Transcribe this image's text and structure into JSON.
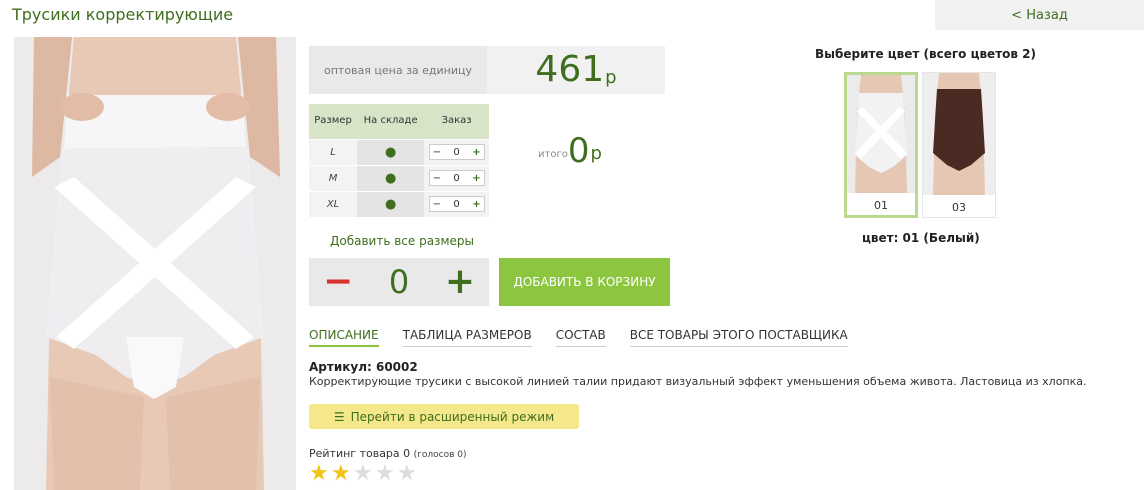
{
  "product": {
    "title": "Трусики корректирующие",
    "back_label": "< Назад",
    "price_label": "оптовая цена за единицу",
    "price": "461",
    "currency": "р",
    "total_label": "итого",
    "total_value": "0",
    "article_label": "Артикул:",
    "article_value": "60002",
    "description": "Корректирующие трусики с высокой линией талии придают визуальный эффект уменьшения объема живота. Ластовица из хлопка."
  },
  "size_table": {
    "headers": [
      "Размер",
      "На складе",
      "Заказ"
    ],
    "rows": [
      {
        "size": "L",
        "stock": "●",
        "qty": "0"
      },
      {
        "size": "M",
        "stock": "●",
        "qty": "0"
      },
      {
        "size": "XL",
        "stock": "●",
        "qty": "0"
      }
    ],
    "minus": "−",
    "plus": "+"
  },
  "order": {
    "add_all_sizes": "Добавить все размеры",
    "qty": "0",
    "minus": "−",
    "plus": "+",
    "add_to_cart": "ДОБАВИТЬ В КОРЗИНУ"
  },
  "tabs": [
    {
      "label": "ОПИСАНИЕ",
      "active": true
    },
    {
      "label": "ТАБЛИЦА РАЗМЕРОВ",
      "active": false
    },
    {
      "label": "СОСТАВ",
      "active": false
    },
    {
      "label": "ВСЕ ТОВАРЫ ЭТОГО ПОСТАВЩИКА",
      "active": false
    }
  ],
  "extended_mode": {
    "icon": "list-icon",
    "icon_glyph": "☰",
    "label": "Перейти в расширенный режим"
  },
  "rating": {
    "label": "Рейтинг товара",
    "value": "0",
    "votes": "(голосов 0)",
    "stars_filled": 2,
    "stars_total": 5
  },
  "colors": {
    "heading": "Выберите цвет (всего цветов 2)",
    "items": [
      {
        "code": "01",
        "selected": true,
        "hex": "#f2f2f4"
      },
      {
        "code": "03",
        "selected": false,
        "hex": "#4a2a22"
      }
    ],
    "caption": "цвет: 01 (Белый)"
  },
  "palette": {
    "accent_green": "#3f6e1e",
    "button_green": "#8cc63f",
    "minus_red": "#d9332c",
    "star_gold": "#f0c419"
  }
}
